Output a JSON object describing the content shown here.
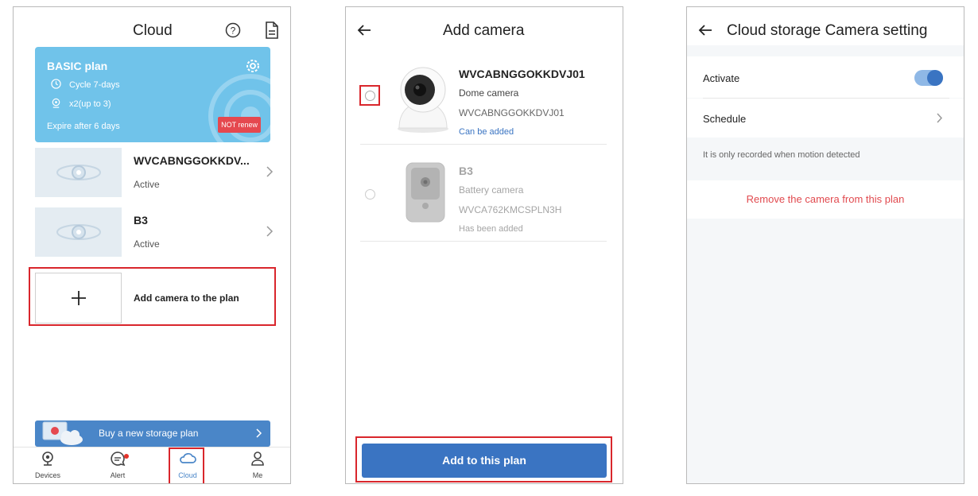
{
  "cloud_screen": {
    "title": "Cloud",
    "plan": {
      "name": "BASIC plan",
      "cycle": "Cycle 7-days",
      "cameras": "x2(up to 3)",
      "expire": "Expire after 6 days",
      "badge": "NOT renew"
    },
    "cameras": [
      {
        "name": "WVCABNGGOKKDV...",
        "status": "Active"
      },
      {
        "name": "B3",
        "status": "Active"
      }
    ],
    "add_camera_label": "Add camera to the plan",
    "buy_label": "Buy a new storage plan",
    "tabs": [
      {
        "label": "Devices"
      },
      {
        "label": "Alert"
      },
      {
        "label": "Cloud"
      },
      {
        "label": "Me"
      }
    ]
  },
  "add_camera_screen": {
    "title": "Add camera",
    "items": [
      {
        "name": "WVCABNGGOKKDVJ01",
        "type": "Dome camera",
        "id": "WVCABNGGOKKDVJ01",
        "note": "Can be added"
      },
      {
        "name": "B3",
        "type": "Battery camera",
        "id": "WVCA762KMCSPLN3H",
        "note": "Has been added"
      }
    ],
    "button_label": "Add to this plan"
  },
  "setting_screen": {
    "title": "Cloud storage Camera setting",
    "activate_label": "Activate",
    "schedule_label": "Schedule",
    "note": "It is only recorded when motion detected",
    "remove_label": "Remove the camera from this plan"
  },
  "colors": {
    "plan_card": "#70c3ea",
    "primary": "#3a74c2",
    "highlight_box": "#d9262c",
    "danger_text": "#e14a4f"
  }
}
